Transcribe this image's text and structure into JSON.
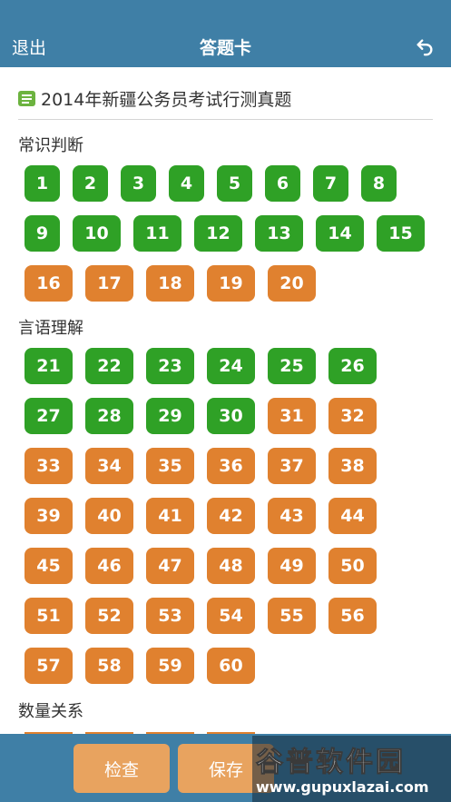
{
  "header": {
    "back_label": "退出",
    "title": "答题卡",
    "undo_icon": "undo-icon",
    "background": "#3f7fa6"
  },
  "paper": {
    "icon": "document-icon",
    "title": "2014年新疆公务员考试行测真题"
  },
  "sections": [
    {
      "title": "常识判断",
      "questions": [
        {
          "n": "1",
          "answered": true
        },
        {
          "n": "2",
          "answered": true
        },
        {
          "n": "3",
          "answered": true
        },
        {
          "n": "4",
          "answered": true
        },
        {
          "n": "5",
          "answered": true
        },
        {
          "n": "6",
          "answered": true
        },
        {
          "n": "7",
          "answered": true
        },
        {
          "n": "8",
          "answered": true
        },
        {
          "n": "9",
          "answered": true
        },
        {
          "n": "10",
          "answered": true
        },
        {
          "n": "11",
          "answered": true
        },
        {
          "n": "12",
          "answered": true
        },
        {
          "n": "13",
          "answered": true
        },
        {
          "n": "14",
          "answered": true
        },
        {
          "n": "15",
          "answered": true
        },
        {
          "n": "16",
          "answered": false
        },
        {
          "n": "17",
          "answered": false
        },
        {
          "n": "18",
          "answered": false
        },
        {
          "n": "19",
          "answered": false
        },
        {
          "n": "20",
          "answered": false
        }
      ]
    },
    {
      "title": "言语理解",
      "questions": [
        {
          "n": "21",
          "answered": true
        },
        {
          "n": "22",
          "answered": true
        },
        {
          "n": "23",
          "answered": true
        },
        {
          "n": "24",
          "answered": true
        },
        {
          "n": "25",
          "answered": true
        },
        {
          "n": "26",
          "answered": true
        },
        {
          "n": "27",
          "answered": true
        },
        {
          "n": "28",
          "answered": true
        },
        {
          "n": "29",
          "answered": true
        },
        {
          "n": "30",
          "answered": true
        },
        {
          "n": "31",
          "answered": false
        },
        {
          "n": "32",
          "answered": false
        },
        {
          "n": "33",
          "answered": false
        },
        {
          "n": "34",
          "answered": false
        },
        {
          "n": "35",
          "answered": false
        },
        {
          "n": "36",
          "answered": false
        },
        {
          "n": "37",
          "answered": false
        },
        {
          "n": "38",
          "answered": false
        },
        {
          "n": "39",
          "answered": false
        },
        {
          "n": "40",
          "answered": false
        },
        {
          "n": "41",
          "answered": false
        },
        {
          "n": "42",
          "answered": false
        },
        {
          "n": "43",
          "answered": false
        },
        {
          "n": "44",
          "answered": false
        },
        {
          "n": "45",
          "answered": false
        },
        {
          "n": "46",
          "answered": false
        },
        {
          "n": "47",
          "answered": false
        },
        {
          "n": "48",
          "answered": false
        },
        {
          "n": "49",
          "answered": false
        },
        {
          "n": "50",
          "answered": false
        },
        {
          "n": "51",
          "answered": false
        },
        {
          "n": "52",
          "answered": false
        },
        {
          "n": "53",
          "answered": false
        },
        {
          "n": "54",
          "answered": false
        },
        {
          "n": "55",
          "answered": false
        },
        {
          "n": "56",
          "answered": false
        },
        {
          "n": "57",
          "answered": false
        },
        {
          "n": "58",
          "answered": false
        },
        {
          "n": "59",
          "answered": false
        },
        {
          "n": "60",
          "answered": false
        }
      ]
    },
    {
      "title": "数量关系",
      "questions": []
    }
  ],
  "colors": {
    "answered": "#2fa126",
    "unanswered": "#e0812f",
    "footer_button": "#e8a35f"
  },
  "footer": {
    "check_label": "检查",
    "save_label": "保存"
  },
  "watermark": {
    "name": "谷普软件园",
    "url": "www.gupuxlazai.com"
  }
}
